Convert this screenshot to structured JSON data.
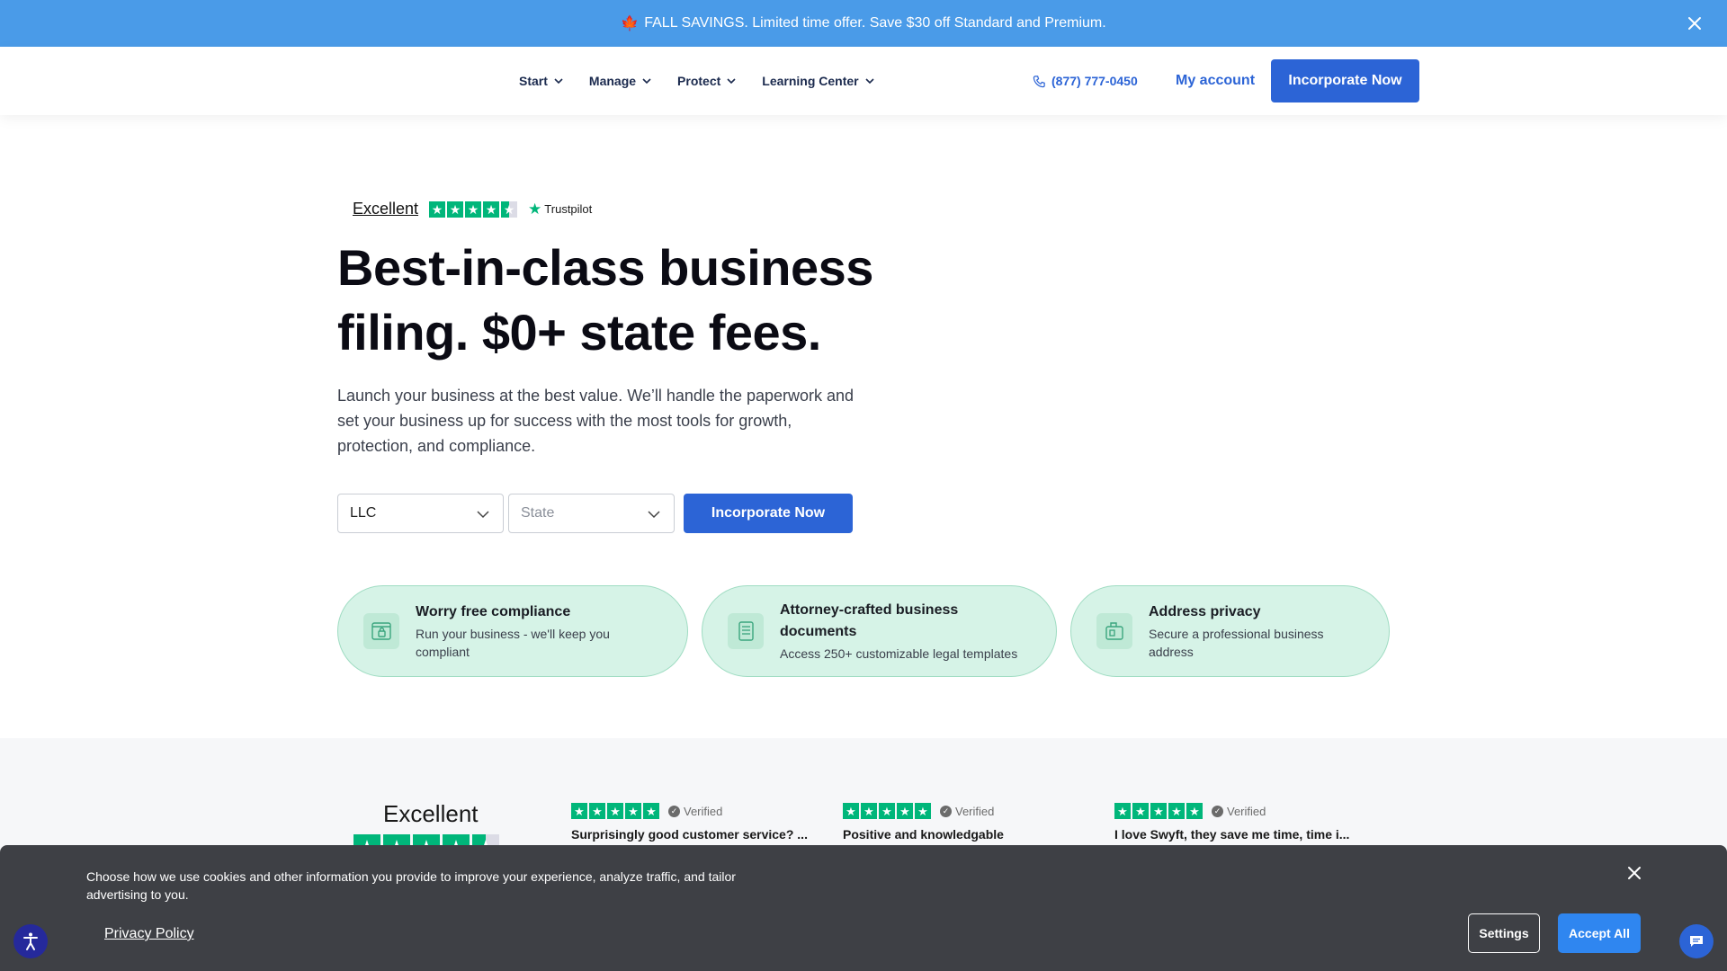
{
  "promo": {
    "text": "FALL SAVINGS. Limited time offer. Save $30 off Standard and Premium.",
    "icon": "maple-leaf-icon"
  },
  "nav": {
    "links": [
      {
        "label": "Start"
      },
      {
        "label": "Manage"
      },
      {
        "label": "Protect"
      },
      {
        "label": "Learning Center"
      }
    ],
    "phone": "(877) 777-0450",
    "my_account": "My account",
    "cta": "Incorporate Now"
  },
  "hero": {
    "trustpilot": {
      "rating_word": "Excellent",
      "brand": "Trustpilot",
      "stars": 4.5
    },
    "title_line1": "Best-in-class business",
    "title_line2": "filing. $0+ state fees.",
    "subtitle": "Launch your business at the best value. We’ll handle the paperwork and set your business up for success with the most tools for growth, protection, and compliance.",
    "entity_select": {
      "value": "LLC"
    },
    "state_select": {
      "placeholder": "State"
    },
    "cta": "Incorporate Now"
  },
  "features": [
    {
      "title": "Worry free compliance",
      "desc": "Run your business - we'll keep you compliant",
      "icon": "lock-browser-icon"
    },
    {
      "title": "Attorney-crafted business documents",
      "desc": "Access 250+ customizable legal templates",
      "icon": "document-icon"
    },
    {
      "title": "Address privacy",
      "desc": "Secure a professional business address",
      "icon": "mailbox-icon"
    }
  ],
  "reviews": {
    "rating_word": "Excellent",
    "stars": 4.5,
    "items": [
      {
        "verified": "Verified",
        "title": "Surprisingly good customer service? ...",
        "stars": 5
      },
      {
        "verified": "Verified",
        "title": "Positive and knowledgable",
        "stars": 5
      },
      {
        "verified": "Verified",
        "title": "I love Swyft, they save me time, time i...",
        "stars": 5
      }
    ]
  },
  "cookie": {
    "text": "Choose how we use cookies and other information you provide to improve your experience, analyze traffic, and tailor advertising to you.",
    "privacy_link": "Privacy Policy",
    "settings": "Settings",
    "accept": "Accept All"
  },
  "colors": {
    "primary": "#2c64d6",
    "promo_bg": "#4a9be8",
    "trustpilot_green": "#00b67a",
    "feature_bg": "#d6f3e7",
    "cookie_bg": "#3e4045"
  }
}
